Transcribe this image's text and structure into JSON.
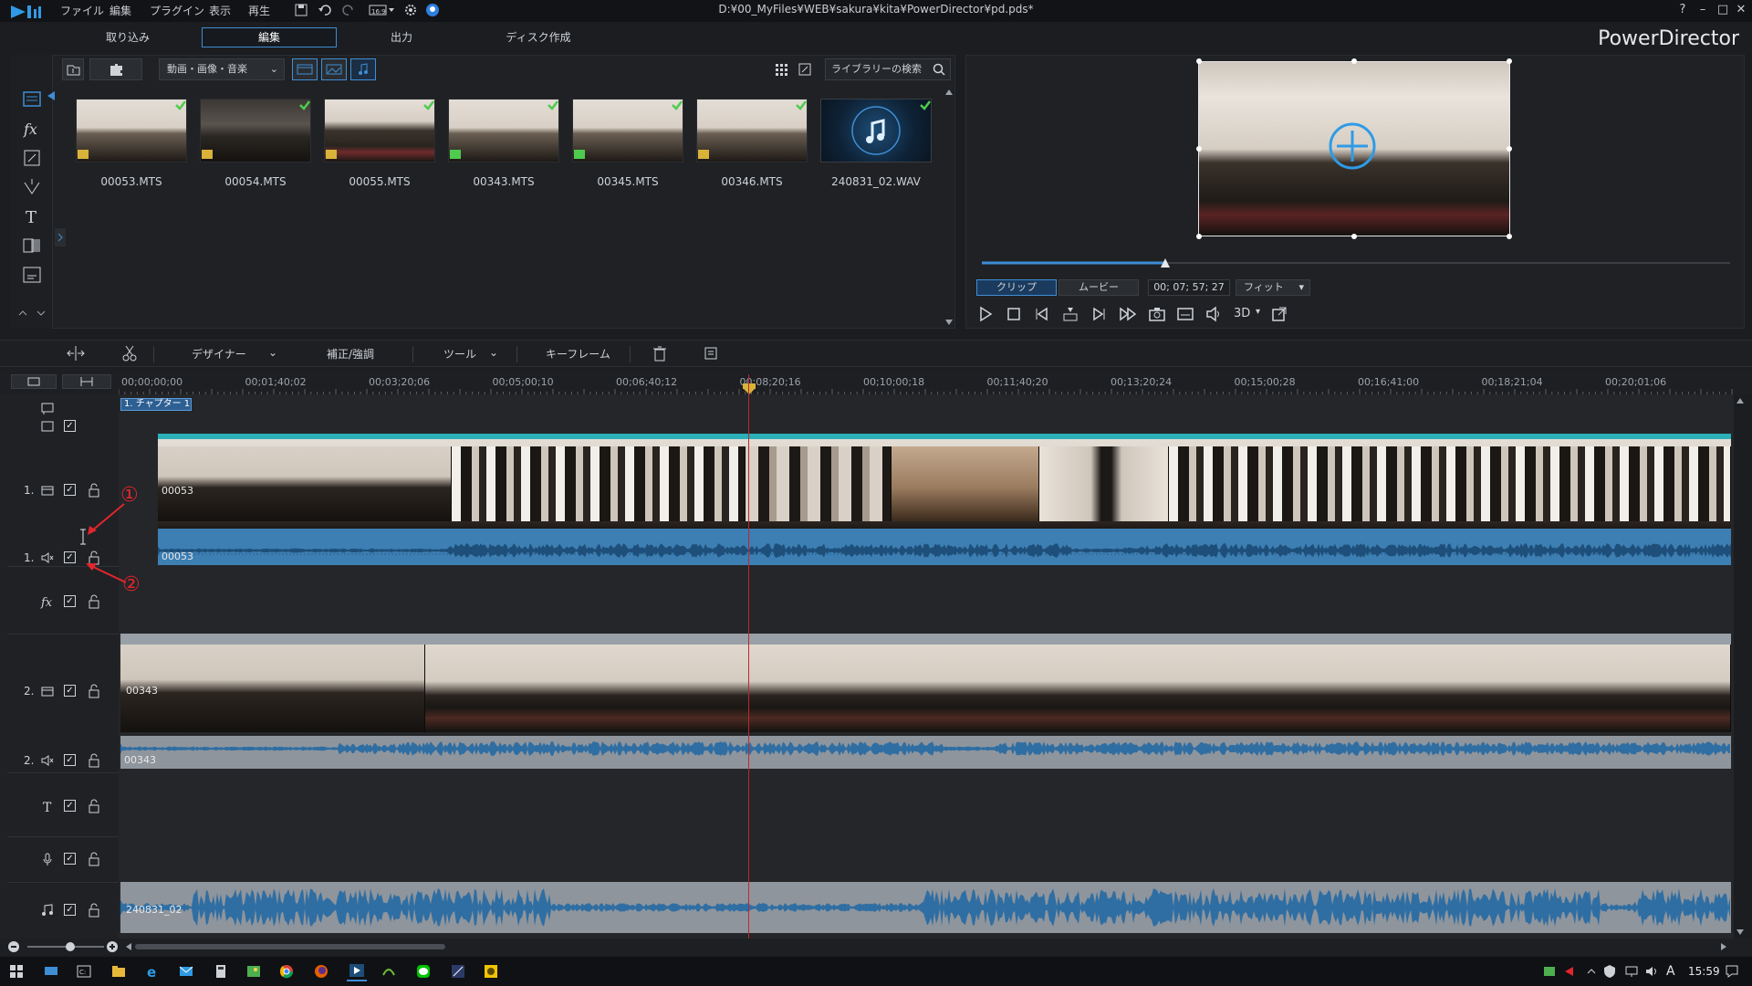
{
  "menu": [
    "ファイル",
    "編集",
    "プラグイン",
    "表示",
    "再生"
  ],
  "doc_title": "D:¥00_MyFiles¥WEB¥sakura¥kita¥PowerDirector¥pd.pds*",
  "window": {
    "help": "?",
    "minimize": "–",
    "restore": "□",
    "close": "✕"
  },
  "mode_tabs": [
    "取り込み",
    "編集",
    "出力",
    "ディスク作成"
  ],
  "brand": "PowerDirector",
  "library": {
    "filter": "動画・画像・音楽",
    "search_placeholder": "ライブラリーの検索",
    "items": [
      {
        "name": "00053.MTS"
      },
      {
        "name": "00054.MTS"
      },
      {
        "name": "00055.MTS"
      },
      {
        "name": "00343.MTS"
      },
      {
        "name": "00345.MTS"
      },
      {
        "name": "00346.MTS"
      },
      {
        "name": "240831_02.WAV"
      }
    ]
  },
  "preview": {
    "clip": "クリップ",
    "movie": "ムービー",
    "timecode": "00; 07; 57; 27",
    "fit": "フィット",
    "three_d": "3D"
  },
  "edit_toolbar": {
    "designer": "デザイナー",
    "fix": "補正/強調",
    "tools": "ツール",
    "keyframe": "キーフレーム"
  },
  "ruler": [
    "00;00;00;00",
    "00;01;40;02",
    "00;03;20;06",
    "00;05;00;10",
    "00;06;40;12",
    "00;08;20;16",
    "00;10;00;18",
    "00;11;40;20",
    "00;13;20;24",
    "00;15;00;28",
    "00;16;41;00",
    "00;18;21;04",
    "00;20;01;06"
  ],
  "chapter": "1. チャプター 1",
  "tracks": {
    "v1": "1.",
    "a1": "1.",
    "v2": "2.",
    "a2": "2.",
    "fx": "fx"
  },
  "clips": {
    "v1": "00053",
    "a1": "00053",
    "v2": "00343",
    "a2": "00343",
    "music": "240831_02"
  },
  "annotations": {
    "one": "①",
    "two": "②"
  },
  "taskbar": {
    "time": "15:59",
    "ime": "A"
  },
  "colors": {
    "accent": "#3e8ed6",
    "audio": "#3d7fb3",
    "playhead": "#c0272d",
    "annotation": "#e0262d"
  }
}
